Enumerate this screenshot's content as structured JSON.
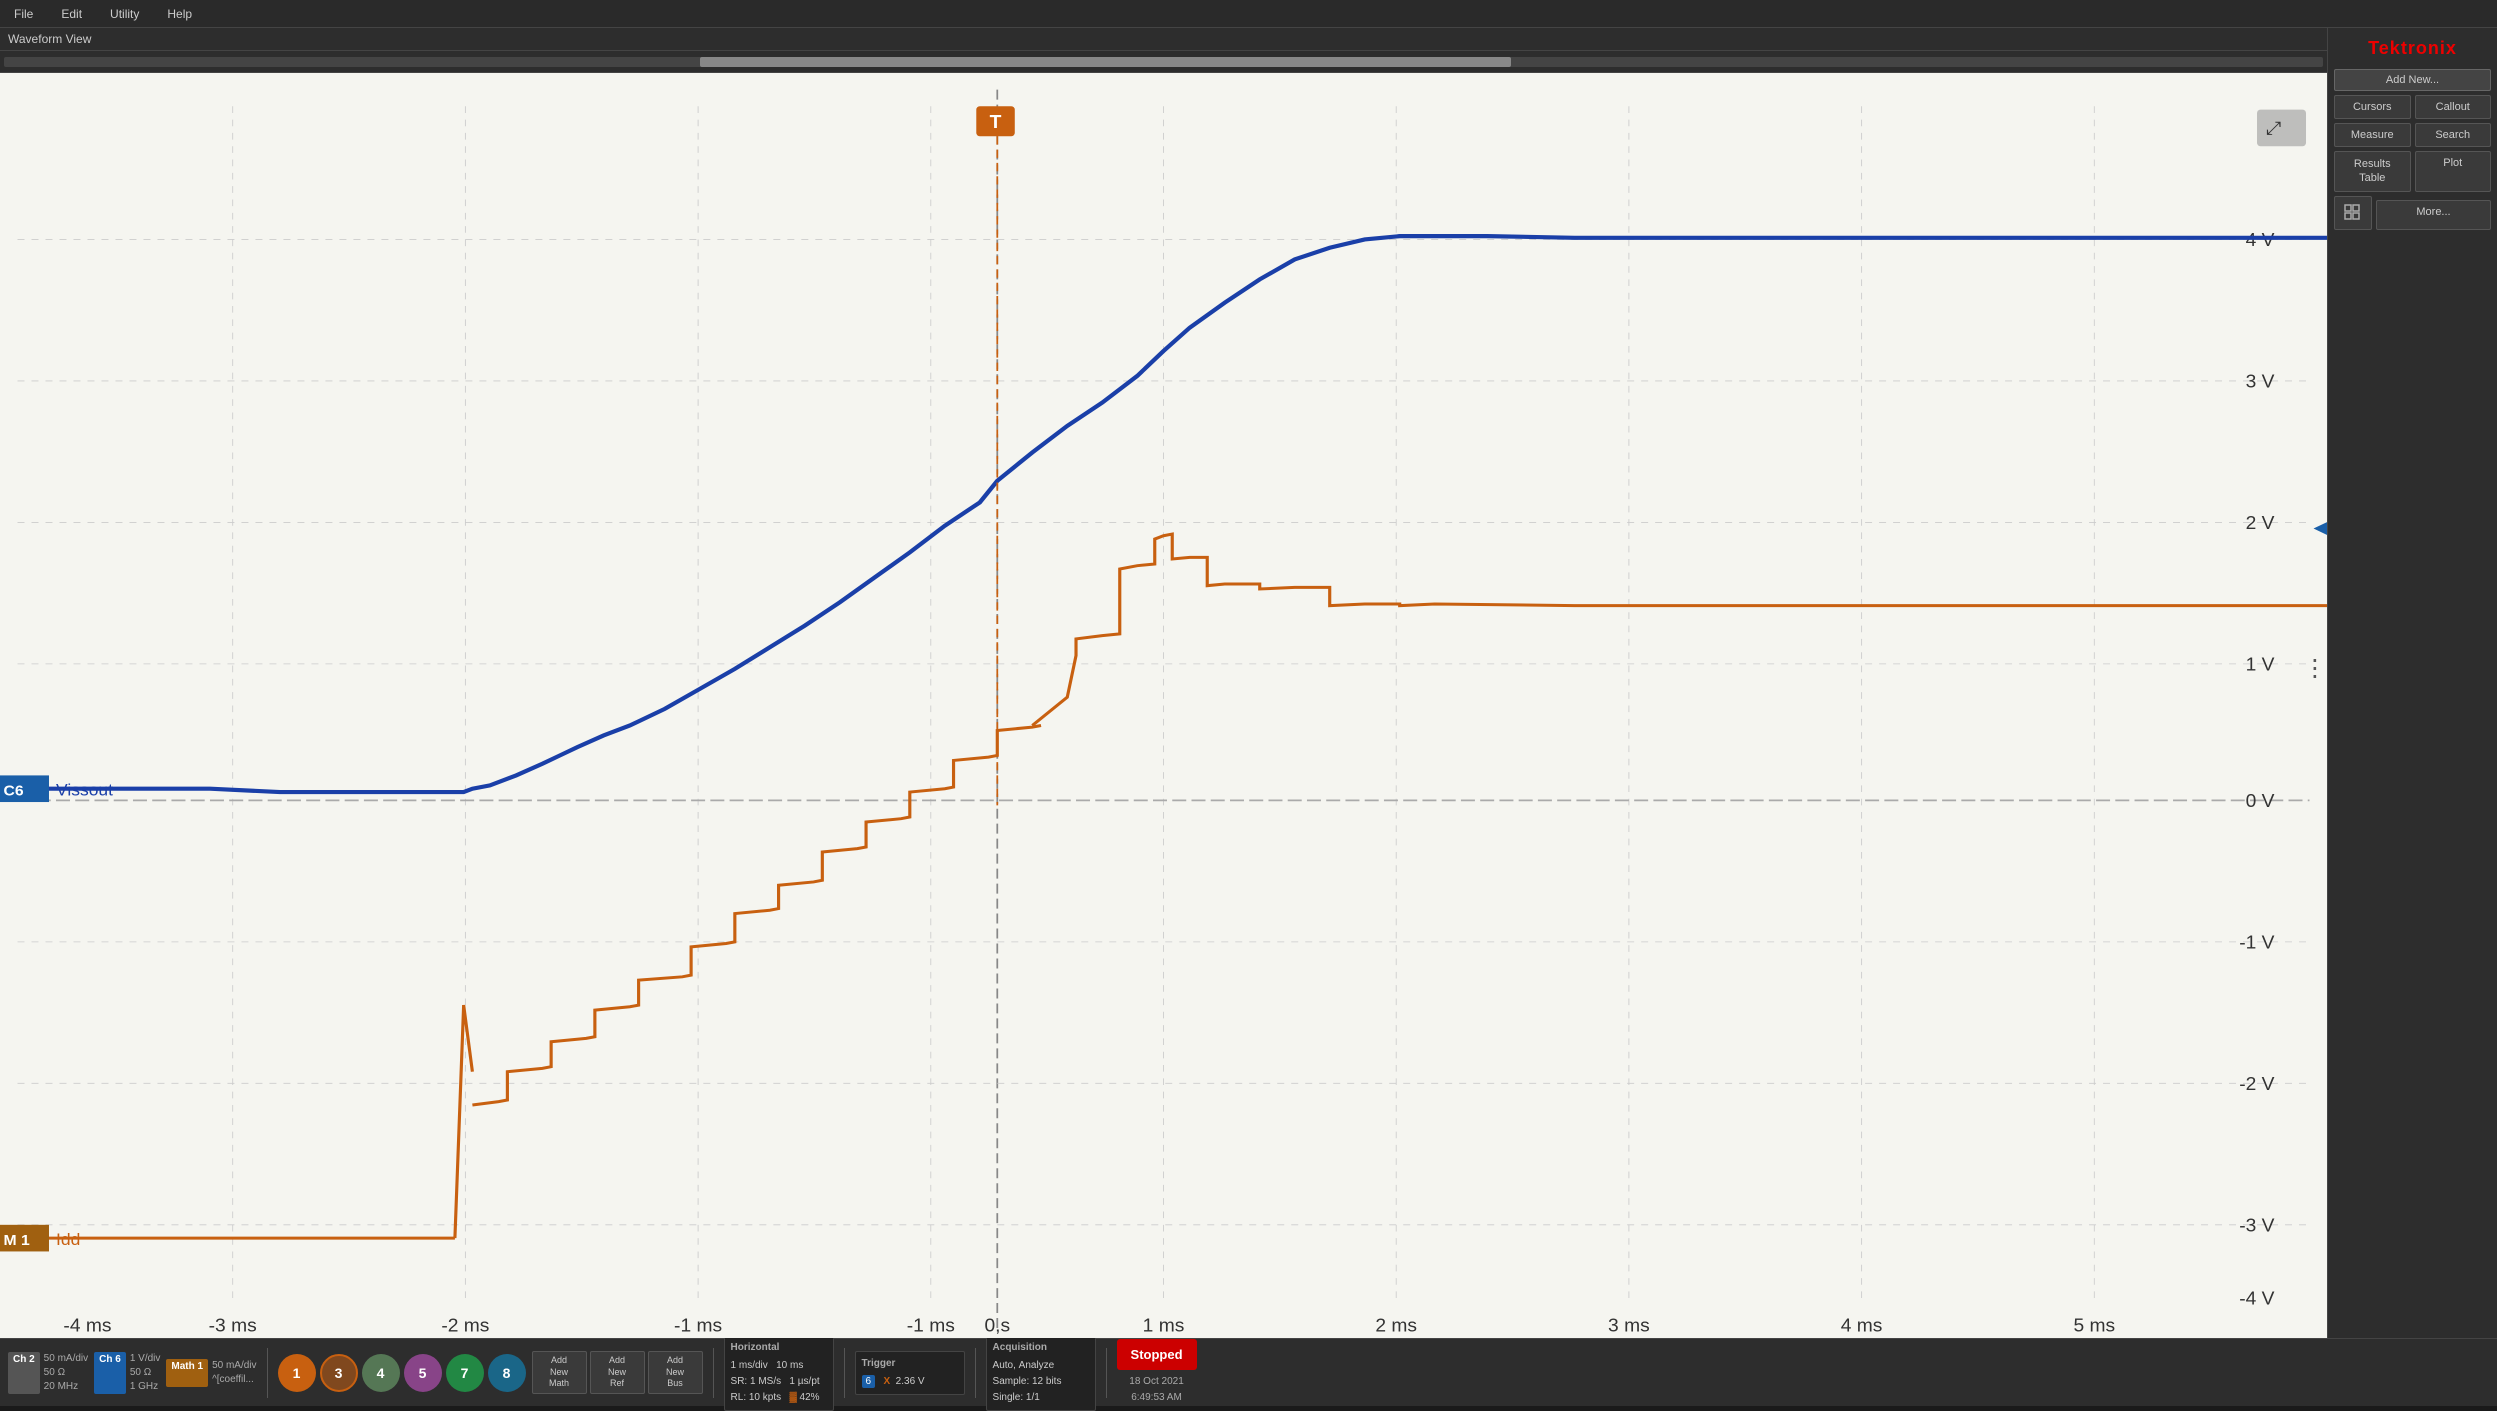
{
  "app": {
    "title": "Tektronix",
    "logo_text": "Tektronix"
  },
  "menu": {
    "items": [
      "File",
      "Edit",
      "Utility",
      "Help"
    ]
  },
  "waveform": {
    "title": "Waveform View",
    "y_labels": [
      "4 V",
      "3 V",
      "2 V",
      "1 V",
      "0 V",
      "-1 V",
      "-2 V",
      "-3 V",
      "-4 V"
    ],
    "x_labels": [
      "-4 ms",
      "-3 ms",
      "-2 ms",
      "-1 ms",
      "0 s",
      "1 ms",
      "2 ms",
      "3 ms",
      "4 ms",
      "5 ms"
    ],
    "channel_label_c6": "Vissout",
    "channel_label_m1": "Idd"
  },
  "right_panel": {
    "add_new_label": "Add New...",
    "cursors_label": "Cursors",
    "callout_label": "Callout",
    "measure_label": "Measure",
    "search_label": "Search",
    "results_table_label": "Results\nTable",
    "plot_label": "Plot",
    "more_label": "More..."
  },
  "bottom": {
    "ch2_label": "Ch 2",
    "ch2_params": [
      "50 mA/div",
      "50 Ω",
      "20 MHz"
    ],
    "ch6_label": "Ch 6",
    "ch6_params": [
      "1 V/div",
      "50 Ω",
      "1 GHz"
    ],
    "math1_label": "Math 1",
    "math1_params": [
      "50 mA/div",
      "^[coeffil..."
    ],
    "channels": [
      "1",
      "3",
      "4",
      "5",
      "7",
      "8"
    ],
    "add_new_math": "Add\nNew\nMath",
    "add_new_ref": "Add\nNew\nRef",
    "add_new_bus": "Add\nNew\nBus",
    "horizontal_title": "Horizontal",
    "horizontal_params": [
      "1 ms/div",
      "SR: 1 MS/s",
      "RL: 10 kpts",
      "10 ms",
      "1 µs/pt",
      "42%"
    ],
    "trigger_title": "Trigger",
    "trigger_ch": "6",
    "trigger_edge": "X",
    "trigger_level": "2.36 V",
    "acquisition_title": "Acquisition",
    "acquisition_mode": "Auto,",
    "acquisition_analyze": "Analyze",
    "acquisition_sample": "Sample: 12 bits",
    "acquisition_single": "Single: 1/1",
    "stopped_label": "Stopped",
    "date": "18 Oct 2021",
    "time": "6:49:53 AM"
  }
}
